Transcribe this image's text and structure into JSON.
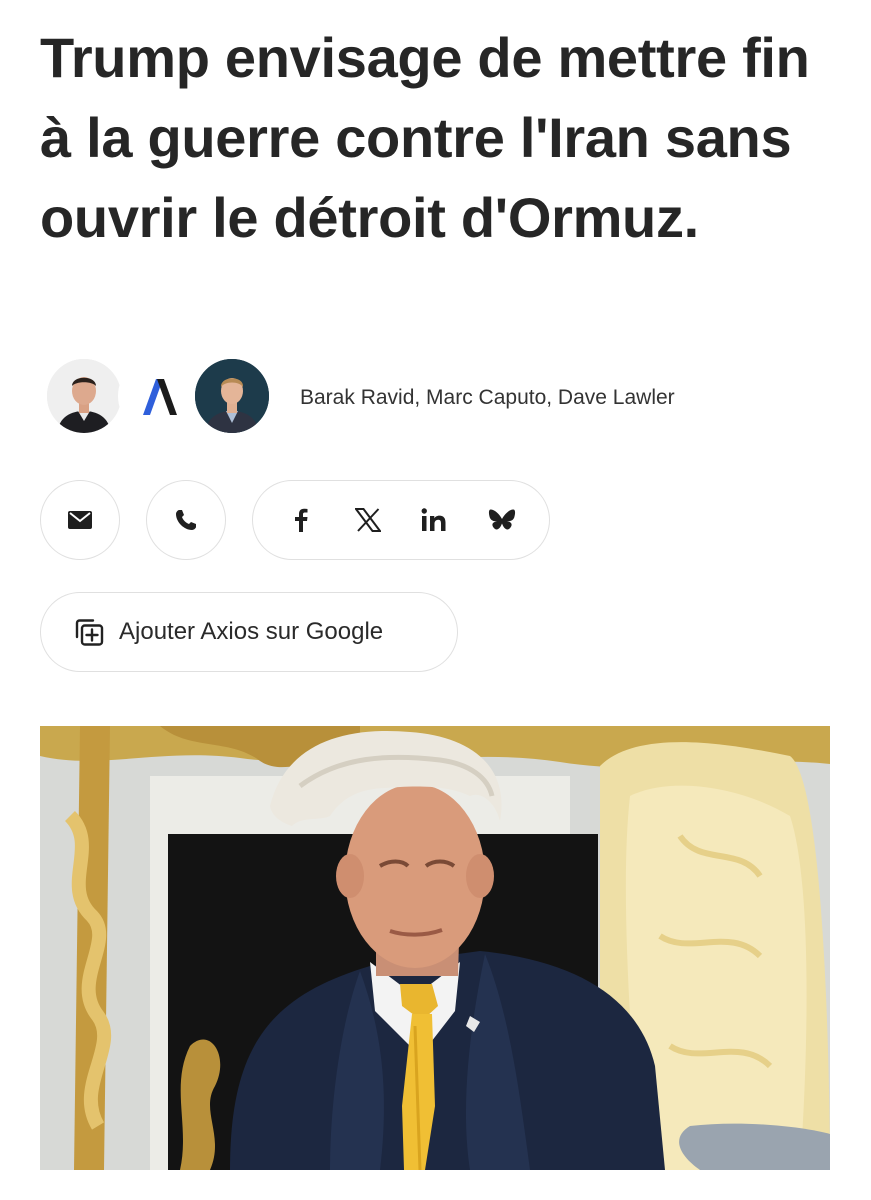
{
  "article": {
    "headline": "Trump envisage de mettre fin à la guerre contre l'Iran sans ouvrir le détroit d'Ormuz.",
    "authors": "Barak Ravid, Marc Caputo, Dave Lawler"
  },
  "share": {
    "icons": [
      "envelope-icon",
      "phone-icon",
      "facebook-icon",
      "x-icon",
      "linkedin-icon",
      "bluesky-icon"
    ]
  },
  "google_button": {
    "label": "Ajouter Axios sur Google",
    "icon": "add-source-icon"
  },
  "colors": {
    "axios_blue": "#2f5fdb",
    "text": "#262626",
    "border": "#e0e0e0"
  }
}
